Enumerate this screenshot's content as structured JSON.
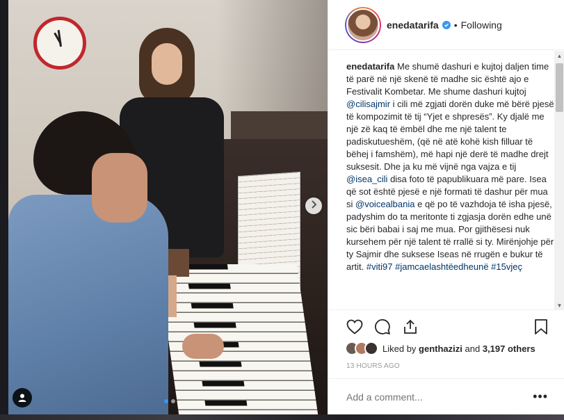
{
  "post": {
    "username": "enedatarifa",
    "follow_status": "Following",
    "separator": "•",
    "caption": {
      "author": "enedatarifa",
      "segments": [
        {
          "text": " Me shumë dashuri e kujtoj daljen time të parë në një skenë të madhe sic është ajo e Festivalit Kombetar. Me shume dashuri kujtoj ",
          "link": false
        },
        {
          "text": "@cilisajmir",
          "link": true
        },
        {
          "text": " i cili më zgjati dorën duke më bërë pjesë të kompozimit të tij “Yjet e shpresës”. Ky djalë me një zë kaq të ëmbël dhe me një talent te padiskutueshëm, (që në atë kohë kish filluar të bëhej i famshëm), më hapi një derë të madhe drejt suksesit. Dhe ja ku më vijnë nga vajza e tij ",
          "link": false
        },
        {
          "text": "@isea_cili",
          "link": true
        },
        {
          "text": " disa foto të papublikuara më pare. Isea që sot është pjesë e një formati të dashur për mua si ",
          "link": false
        },
        {
          "text": "@voicealbania",
          "link": true
        },
        {
          "text": " e që po të vazhdoja të isha pjesë, padyshim do ta meritonte ti zgjasja dorën edhe unë sic bëri babai i saj me mua. Por gjithësesi nuk kursehem për një talent të rrallë si ty. Mirënjohje për ty Sajmir dhe suksese Iseas në rrugën e bukur të artit. ",
          "link": false
        },
        {
          "text": "#viti97",
          "link": true
        },
        {
          "text": " ",
          "link": false
        },
        {
          "text": "#jamcaelashtëedheunë",
          "link": true
        },
        {
          "text": " ",
          "link": false
        },
        {
          "text": "#15vjeç",
          "link": true
        }
      ]
    },
    "likes": {
      "prefix": "Liked by ",
      "first_liker": "genthazizi",
      "middle": " and ",
      "others": "3,197 others"
    },
    "timestamp": "13 HOURS AGO",
    "comment": {
      "placeholder": "Add a comment...",
      "more_label": "•••"
    }
  },
  "carousel": {
    "count": 2,
    "active_index": 0
  },
  "icons": {
    "verified": "verified-badge-icon",
    "like": "heart-icon",
    "comment": "comment-bubble-icon",
    "share": "share-icon",
    "save": "bookmark-icon",
    "next": "chevron-right-icon",
    "tag": "user-tag-icon"
  },
  "colors": {
    "verified": "#3897f0",
    "link": "#003569",
    "active_dot": "#3897f0",
    "meta_text": "#999999"
  }
}
